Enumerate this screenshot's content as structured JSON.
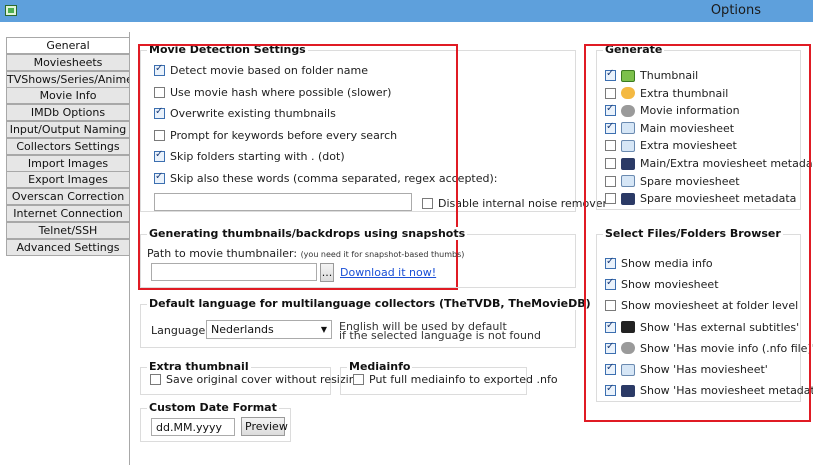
{
  "window": {
    "title": "Options"
  },
  "tabs": [
    "General",
    "Moviesheets",
    "TVShows/Series/Anime",
    "Movie Info",
    "IMDb Options",
    "Input/Output Naming",
    "Collectors Settings",
    "Import Images",
    "Export Images",
    "Overscan Correction",
    "Internet Connection",
    "Telnet/SSH",
    "Advanced Settings"
  ],
  "movie_detection": {
    "title": "Movie Detection Settings",
    "options": [
      {
        "label": "Detect movie based on folder name",
        "checked": true
      },
      {
        "label": "Use movie hash where possible (slower)",
        "checked": false
      },
      {
        "label": "Overwrite existing thumbnails",
        "checked": true
      },
      {
        "label": "Prompt for keywords before every search",
        "checked": false
      },
      {
        "label": "Skip folders starting with . (dot)",
        "checked": true
      },
      {
        "label": "Skip also these words (comma separated, regex accepted):",
        "checked": true
      }
    ],
    "skip_words_value": "",
    "noise_remover": {
      "label": "Disable internal noise remover",
      "checked": false
    }
  },
  "snapshots": {
    "title": "Generating thumbnails/backdrops using snapshots",
    "path_label": "Path to movie thumbnailer:",
    "path_note": "(you need it for snapshot-based thumbs)",
    "path_value": "",
    "browse_label": "...",
    "download_link": "Download it now!"
  },
  "language": {
    "title": "Default language for multilanguage collectors (TheTVDB, TheMovieDB)",
    "label": "Language:",
    "selected": "Nederlands",
    "note_line1": "English will be used by default",
    "note_line2": "if the selected language is not found"
  },
  "extra_thumbnail": {
    "title": "Extra thumbnail",
    "option": {
      "label": "Save original cover without resizing",
      "checked": false
    }
  },
  "mediainfo": {
    "title": "Mediainfo",
    "option": {
      "label": "Put full mediainfo to exported .nfo",
      "checked": false
    }
  },
  "custom_date": {
    "title": "Custom Date Format",
    "value": "dd.MM.yyyy",
    "preview_label": "Preview"
  },
  "generate": {
    "title": "Generate",
    "items": [
      {
        "label": "Thumbnail",
        "checked": true,
        "icon": "thumbnail-icon"
      },
      {
        "label": "Extra thumbnail",
        "checked": false,
        "icon": "extra-thumbnail-icon"
      },
      {
        "label": "Movie information",
        "checked": true,
        "icon": "movie-info-icon"
      },
      {
        "label": "Main moviesheet",
        "checked": true,
        "icon": "moviesheet-icon"
      },
      {
        "label": "Extra moviesheet",
        "checked": false,
        "icon": "moviesheet-icon"
      },
      {
        "label": "Main/Extra moviesheet metadata",
        "checked": false,
        "icon": "metadata-icon"
      },
      {
        "label": "Spare moviesheet",
        "checked": false,
        "icon": "moviesheet-icon"
      },
      {
        "label": "Spare moviesheet metadata",
        "checked": false,
        "icon": "metadata-icon"
      }
    ]
  },
  "browser": {
    "title": "Select Files/Folders Browser",
    "items": [
      {
        "label": "Show media info",
        "checked": true,
        "icon": ""
      },
      {
        "label": "Show moviesheet",
        "checked": true,
        "icon": ""
      },
      {
        "label": "Show moviesheet at folder level",
        "checked": false,
        "icon": ""
      },
      {
        "label": "Show 'Has external subtitles'",
        "checked": true,
        "icon": "subtitles-icon"
      },
      {
        "label": "Show 'Has movie info (.nfo file)'",
        "checked": true,
        "icon": "movie-info-icon"
      },
      {
        "label": "Show 'Has moviesheet'",
        "checked": true,
        "icon": "moviesheet-icon"
      },
      {
        "label": "Show 'Has moviesheet metadata'",
        "checked": true,
        "icon": "metadata-icon"
      }
    ]
  },
  "colors": {
    "titlebar": "#5ea0dc",
    "highlight": "#e01b24",
    "link": "#1a4fd6"
  }
}
